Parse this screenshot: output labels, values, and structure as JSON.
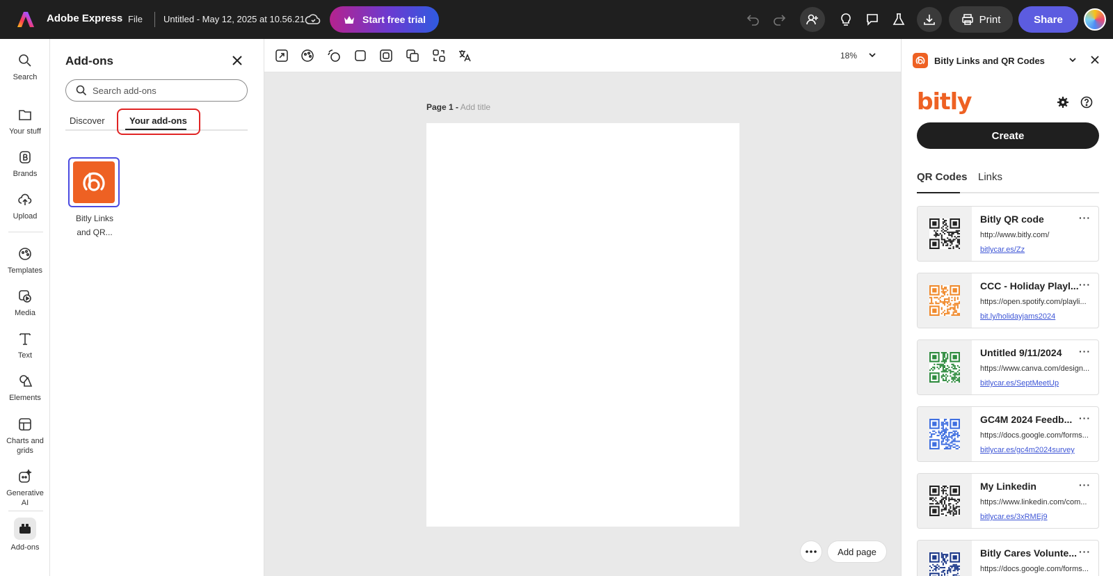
{
  "topbar": {
    "app_name": "Adobe Express",
    "file_label": "File",
    "doc_title": "Untitled - May 12, 2025 at 10.56.21",
    "trial_label": "Start free trial",
    "print_label": "Print",
    "share_label": "Share",
    "icons": [
      "undo-icon",
      "redo-icon",
      "invite-icon",
      "tips-icon",
      "comments-icon",
      "labs-icon",
      "download-icon"
    ]
  },
  "rail": {
    "items": [
      {
        "label": "Search",
        "icon": "search-icon"
      },
      {
        "label": "Your stuff",
        "icon": "folder-icon"
      },
      {
        "label": "Brands",
        "icon": "brand-icon"
      },
      {
        "label": "Upload",
        "icon": "upload-icon"
      },
      {
        "label": "Templates",
        "icon": "templates-icon"
      },
      {
        "label": "Media",
        "icon": "media-icon"
      },
      {
        "label": "Text",
        "icon": "text-icon"
      },
      {
        "label": "Elements",
        "icon": "elements-icon"
      },
      {
        "label": "Charts and grids",
        "icon": "charts-icon"
      },
      {
        "label": "Generative AI",
        "icon": "generative-ai-icon"
      },
      {
        "label": "Add-ons",
        "icon": "addons-icon"
      }
    ]
  },
  "addons": {
    "title": "Add-ons",
    "search_placeholder": "Search add-ons",
    "tabs": [
      "Discover",
      "Your add-ons"
    ],
    "active_tab": "Your add-ons",
    "installed": [
      {
        "label_line1": "Bitly Links",
        "label_line2": "and QR..."
      }
    ]
  },
  "canvas": {
    "zoom": "18%",
    "page_label": "Page 1 -",
    "page_title_placeholder": "Add title",
    "add_page_label": "Add page"
  },
  "bitly": {
    "panel_title": "Bitly Links and QR Codes",
    "wordmark": "bitly",
    "create_label": "Create",
    "tabs": [
      "QR Codes",
      "Links"
    ],
    "active_tab": "QR Codes",
    "qr_codes": [
      {
        "name": "Bitly QR code",
        "destination": "http://www.bitly.com/",
        "short_link": "bitlycar.es/Zz",
        "color": "#222222"
      },
      {
        "name": "CCC - Holiday Playl...",
        "destination": "https://open.spotify.com/playli...",
        "short_link": "bit.ly/holidayjams2024",
        "color": "#f08a2c"
      },
      {
        "name": "Untitled 9/11/2024",
        "destination": "https://www.canva.com/design...",
        "short_link": "bitlycar.es/SeptMeetUp",
        "color": "#2e8b3e"
      },
      {
        "name": "GC4M 2024 Feedb...",
        "destination": "https://docs.google.com/forms...",
        "short_link": "bitlycar.es/gc4m2024survey",
        "color": "#3f6fe0"
      },
      {
        "name": "My Linkedin",
        "destination": "https://www.linkedin.com/com...",
        "short_link": "bitlycar.es/3xRMEj9",
        "color": "#222222"
      },
      {
        "name": "Bitly Cares Volunte...",
        "destination": "https://docs.google.com/forms...",
        "short_link": "",
        "color": "#1e3a8a"
      }
    ]
  }
}
